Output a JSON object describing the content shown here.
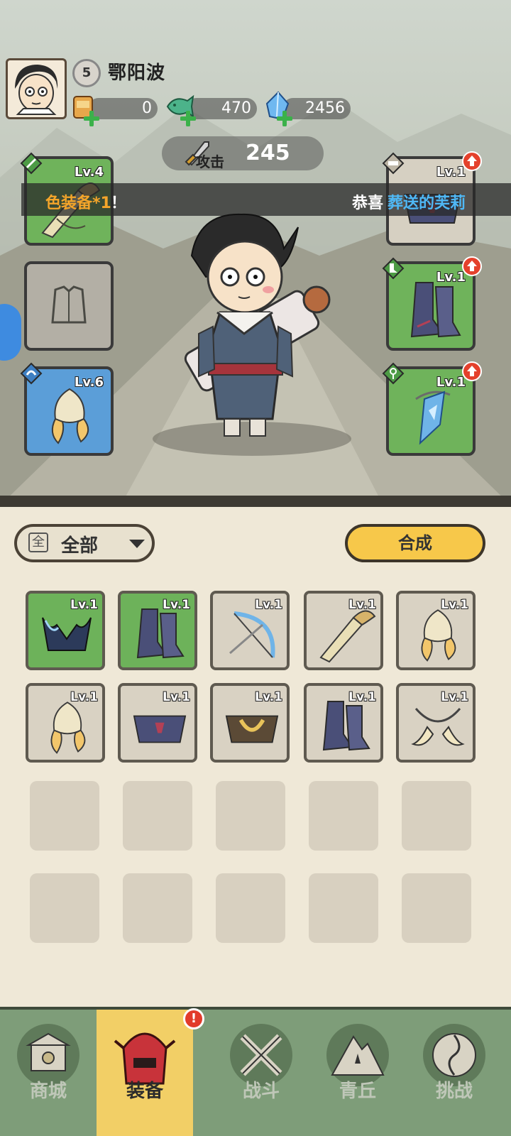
{
  "player": {
    "name": "鄂阳波",
    "level": "5"
  },
  "resources": [
    {
      "name": "scroll",
      "value": "0"
    },
    {
      "name": "jade-fish",
      "value": "470"
    },
    {
      "name": "crystal",
      "value": "2456"
    }
  ],
  "attack": {
    "label": "攻击",
    "value": "245"
  },
  "ticker": {
    "left": "色装备*1",
    "left_end": "！",
    "right_prefix": "恭喜",
    "right_name": "葬送的芙莉"
  },
  "equip_slots": [
    {
      "slot": "weapon",
      "level": "Lv.4",
      "rarity": "green",
      "upgrade": false
    },
    {
      "slot": "armor",
      "level": "",
      "rarity": "empty",
      "upgrade": false
    },
    {
      "slot": "helmet",
      "level": "Lv.6",
      "rarity": "blue",
      "upgrade": false
    },
    {
      "slot": "belt",
      "level": "Lv.1",
      "rarity": "gray",
      "upgrade": true
    },
    {
      "slot": "boots",
      "level": "Lv.1",
      "rarity": "green",
      "upgrade": true
    },
    {
      "slot": "necklace",
      "level": "Lv.1",
      "rarity": "green",
      "upgrade": true
    }
  ],
  "filter": {
    "icon": "全",
    "label": "全部"
  },
  "synth_button": "合成",
  "inventory": [
    {
      "type": "helmet",
      "level": "Lv.1",
      "rarity": "green"
    },
    {
      "type": "boots",
      "level": "Lv.1",
      "rarity": "green"
    },
    {
      "type": "weapon",
      "level": "Lv.1",
      "rarity": "gray"
    },
    {
      "type": "weapon",
      "level": "Lv.1",
      "rarity": "gray"
    },
    {
      "type": "helmet",
      "level": "Lv.1",
      "rarity": "gray"
    },
    {
      "type": "helmet",
      "level": "Lv.1",
      "rarity": "gray"
    },
    {
      "type": "belt",
      "level": "Lv.1",
      "rarity": "gray"
    },
    {
      "type": "belt",
      "level": "Lv.1",
      "rarity": "gray"
    },
    {
      "type": "boots",
      "level": "Lv.1",
      "rarity": "gray"
    },
    {
      "type": "necklace",
      "level": "Lv.1",
      "rarity": "gray"
    }
  ],
  "nav": [
    {
      "label": "商城",
      "icon": "shop-icon",
      "active": false
    },
    {
      "label": "装备",
      "icon": "equipment-icon",
      "active": true,
      "alert": "!"
    },
    {
      "label": "战斗",
      "icon": "crossed-swords-icon",
      "active": false
    },
    {
      "label": "青丘",
      "icon": "mountain-icon",
      "active": false
    },
    {
      "label": "挑战",
      "icon": "challenge-icon",
      "active": false
    }
  ],
  "colors": {
    "accent": "#f7c84a",
    "green_rarity": "#6db25a",
    "blue_rarity": "#5b9ed8",
    "ticker_highlight": "#4fb8f5"
  }
}
